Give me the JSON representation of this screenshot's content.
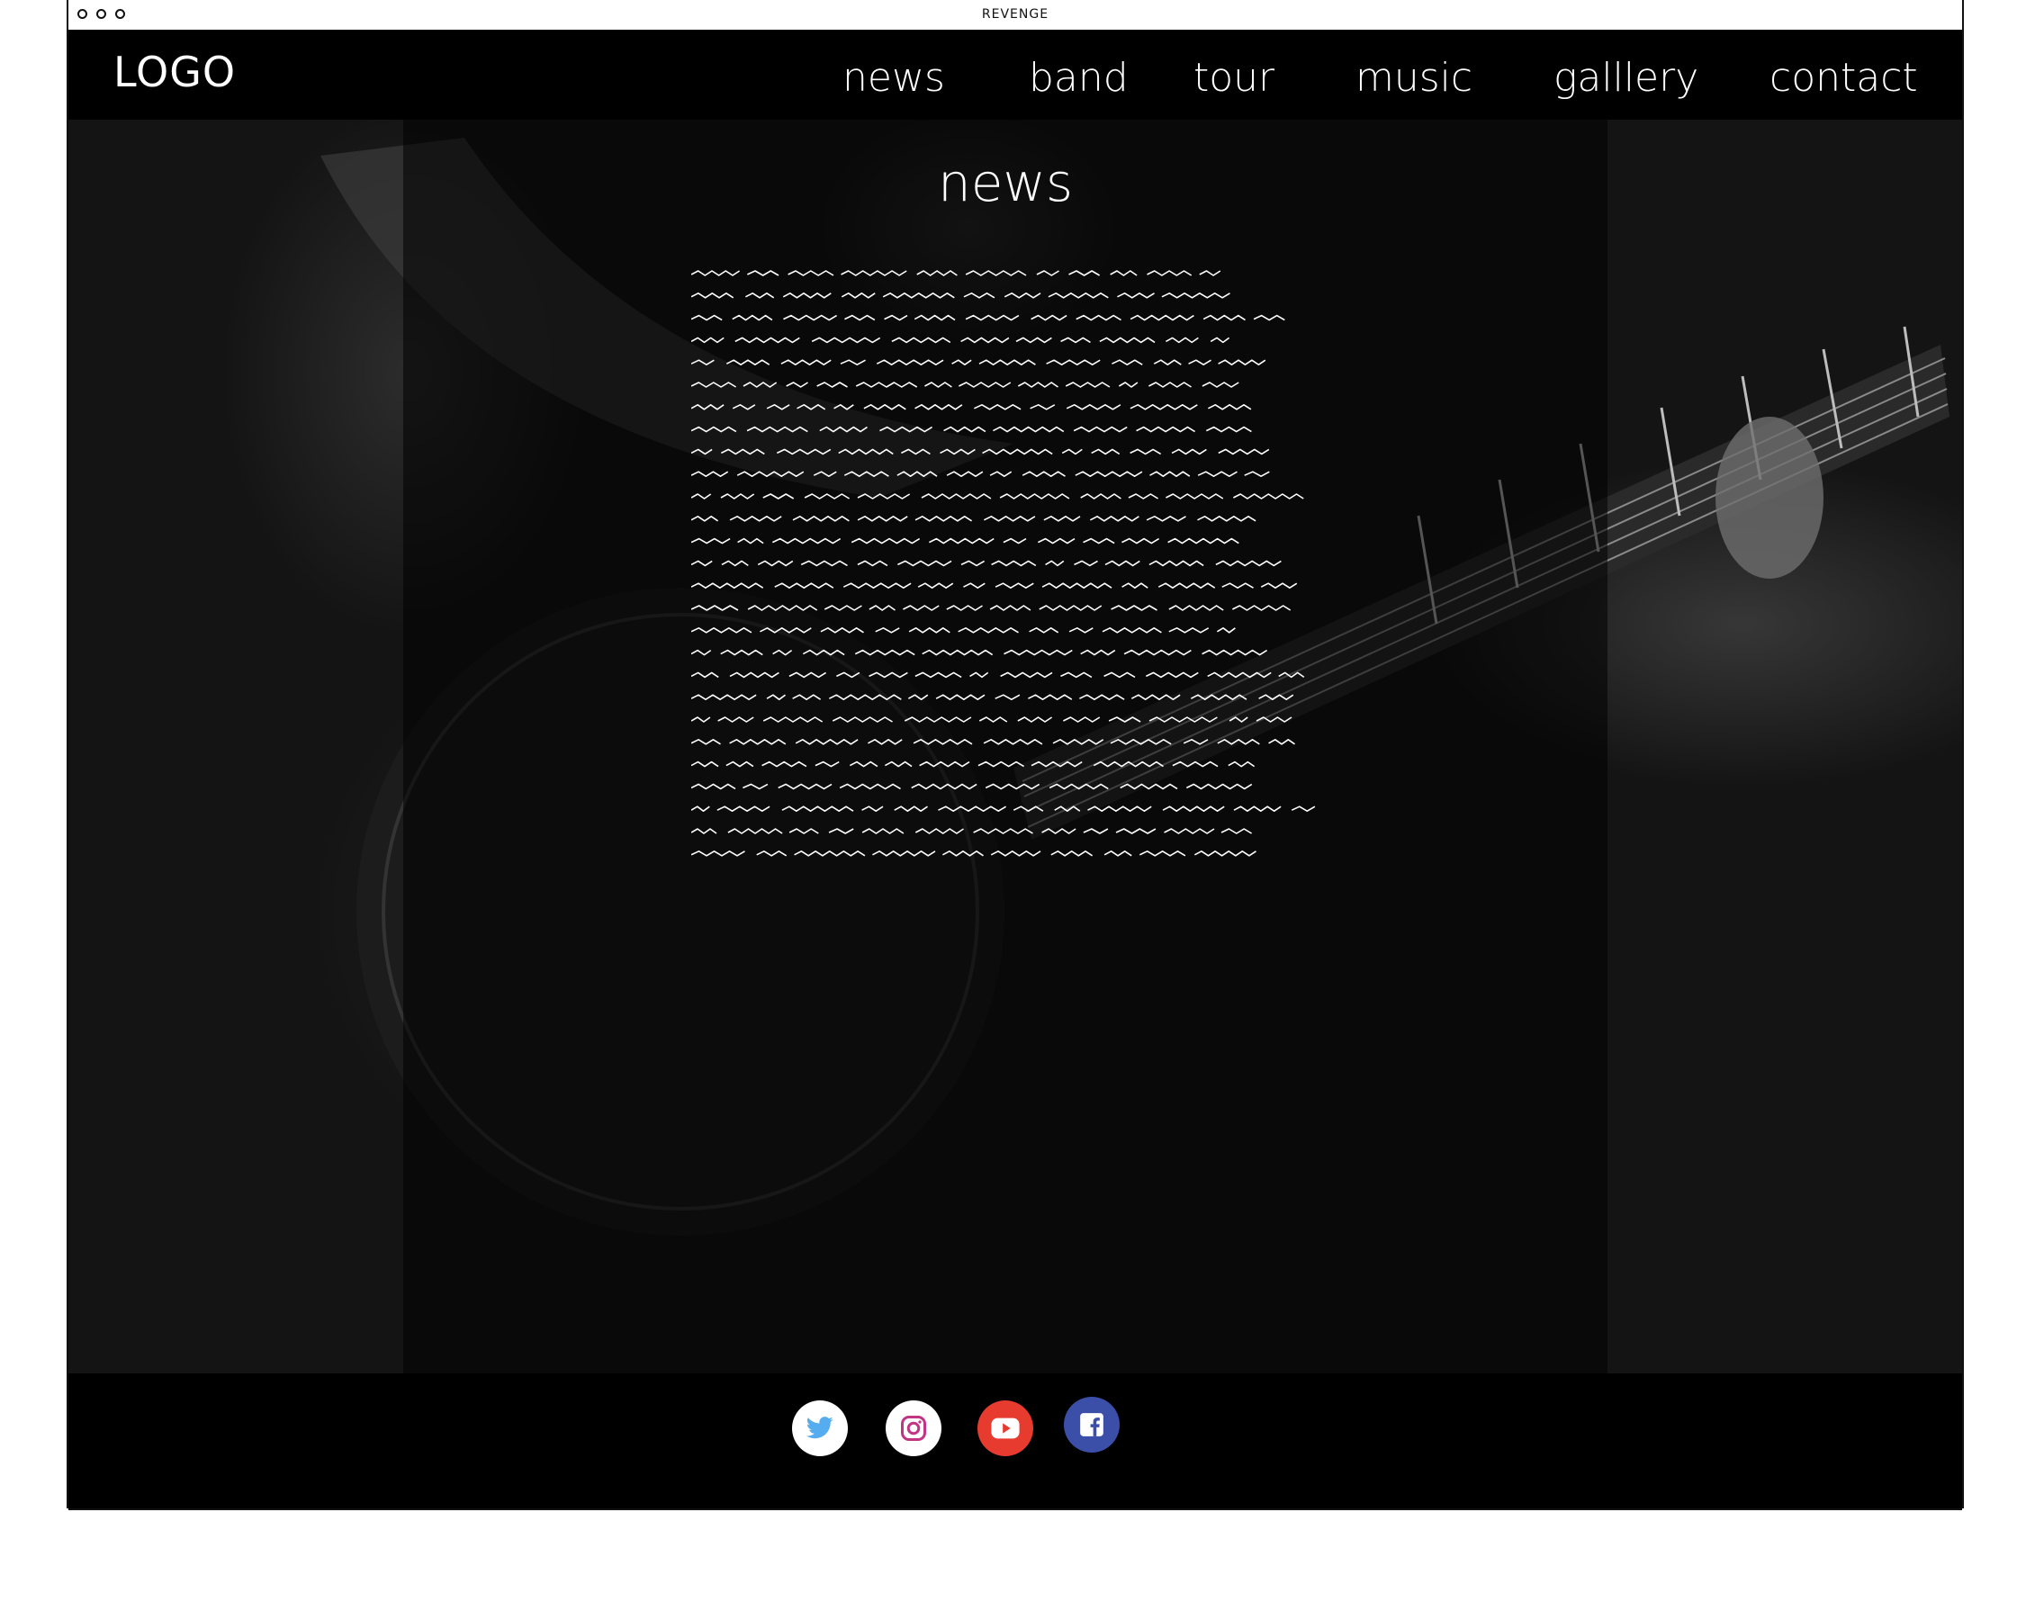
{
  "window": {
    "title": "REVENGE"
  },
  "header": {
    "logo": "LOGO",
    "nav": [
      {
        "label": "news"
      },
      {
        "label": "band"
      },
      {
        "label": "tour"
      },
      {
        "label": "music"
      },
      {
        "label": "galllery"
      },
      {
        "label": "contact"
      }
    ]
  },
  "main": {
    "title": "news",
    "body_placeholder_lines": 27
  },
  "footer": {
    "social": [
      {
        "icon": "twitter-icon",
        "bg": "#ffffff",
        "color": "#55acee"
      },
      {
        "icon": "instagram-icon",
        "bg": "#ffffff",
        "color": "#c13584"
      },
      {
        "icon": "youtube-icon",
        "bg": "#e63b2e",
        "color": "#ffffff"
      },
      {
        "icon": "facebook-icon",
        "bg": "#3b4ea8",
        "color": "#ffffff"
      }
    ]
  },
  "colors": {
    "nav_bg": "#000000",
    "page_bg": "#141414",
    "text": "#ffffff"
  }
}
